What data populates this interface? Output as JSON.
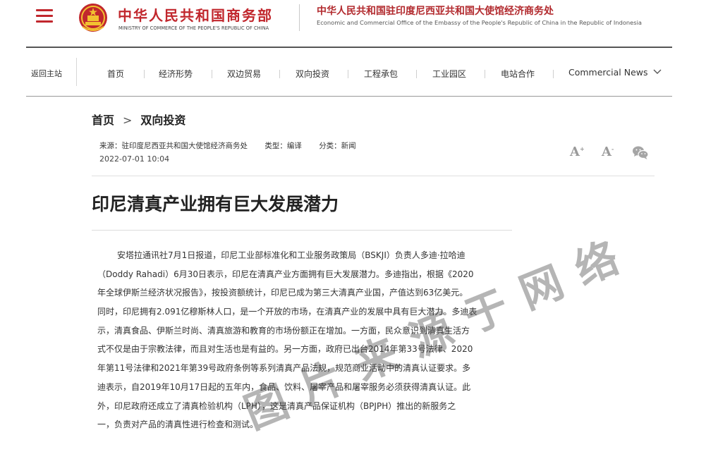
{
  "header": {
    "mofcom_cn": "中华人民共和国商务部",
    "mofcom_en": "MINISTRY OF COMMERCE OF THE PEOPLE'S REPUBLIC OF CHINA",
    "office_cn": "中华人民共和国驻印度尼西亚共和国大使馆经济商务处",
    "office_en": "Economic and Commercial Office of the Embassy of the People's Republic of China in the Republic of Indonesia"
  },
  "nav": {
    "back": "返回主站",
    "items": [
      "首页",
      "经济形势",
      "双边贸易",
      "双向投资",
      "工程承包",
      "工业园区",
      "电站合作"
    ],
    "more": "Commercial News"
  },
  "breadcrumb": {
    "home": "首页",
    "separator": ">",
    "current": "双向投资"
  },
  "meta": {
    "source": "来源：驻印度尼西亚共和国大使馆经济商务处",
    "type": "类型：编译",
    "category": "分类：新闻",
    "date": "2022-07-01 10:04"
  },
  "tools": {
    "font_large": "A",
    "font_small": "A",
    "font_large_sup": "+",
    "font_small_sup": "-"
  },
  "article": {
    "title": "印尼清真产业拥有巨大发展潜力",
    "lines": [
      "安塔拉通讯社7月1日报道，印尼工业部标准化和工业服务政策局（BSKJI）负责人多迪·拉哈迪",
      "（Doddy Rahadi）6月30日表示，印尼在清真产业方面拥有巨大发展潜力。多迪指出，根据《2020",
      "年全球伊斯兰经济状况报告》，按投资额统计，印尼已成为第三大清真产业国，产值达到63亿美元。",
      "同时，印尼拥有2.091亿穆斯林人口，是一个开放的市场，在清真产业的发展中具有巨大潜力。多迪表",
      "示，清真食品、伊斯兰时尚、清真旅游和教育的市场份额正在增加。一方面，民众意识到清真生活方",
      "式不仅是由于宗教法律，而且对生活也是有益的。另一方面，政府已出台2014年第33号法律、2020",
      "年第11号法律和2021年第39号政府条例等系列清真产品法规，规范商业活动中的清真认证要求。多",
      "迪表示，自2019年10月17日起的五年内，食品、饮料、屠宰产品和屠宰服务必须获得清真认证。此",
      "外，印尼政府还成立了清真检验机构（LPH），这是清真产品保证机构（BPJPH）推出的新服务之",
      "一，负责对产品的清真性进行检查和测试。"
    ]
  },
  "watermark": [
    "图",
    "片",
    "来",
    "源",
    "于",
    "网",
    "络"
  ],
  "colors": {
    "brand_red": "#c1272d",
    "text": "#333333",
    "muted_icon": "#9a9a9a"
  }
}
